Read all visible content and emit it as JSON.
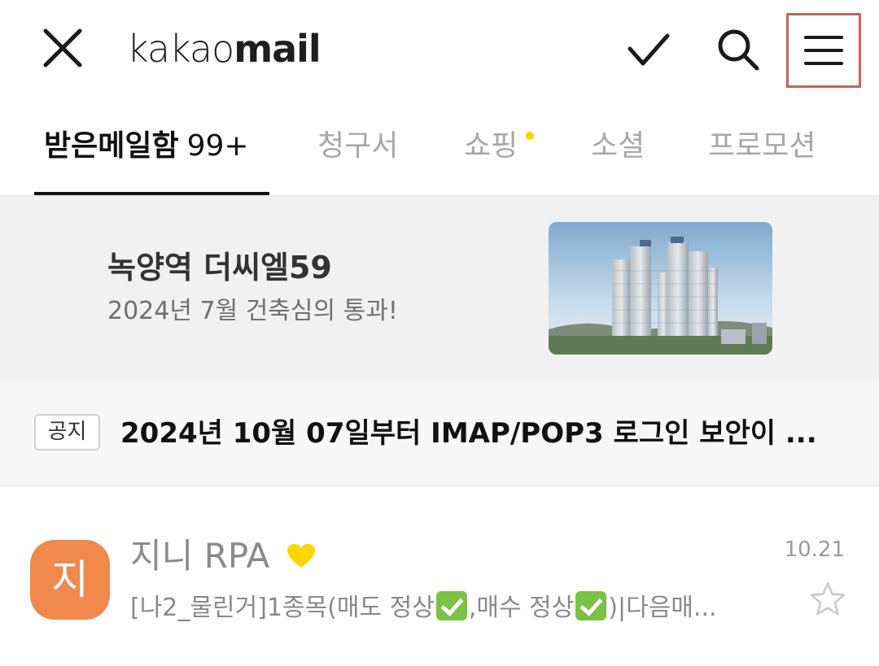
{
  "header": {
    "logo_light": "kakao",
    "logo_bold": "mail",
    "icons": {
      "close": "close-icon",
      "check": "check-icon",
      "search": "search-icon",
      "menu": "menu-icon"
    },
    "menu_highlight_color": "#c8654c"
  },
  "tabs": [
    {
      "label": "받은메일함",
      "count": "99+",
      "active": true
    },
    {
      "label": "청구서"
    },
    {
      "label": "쇼핑",
      "has_dot": true
    },
    {
      "label": "소셜"
    },
    {
      "label": "프로모션"
    }
  ],
  "banner": {
    "title": "녹양역 더씨엘59",
    "subtitle": "2024년 7월 건축심의 통과!"
  },
  "notice": {
    "badge": "공지",
    "text": "2024년 10월 07일부터 IMAP/POP3 로그인 보안이 ..."
  },
  "mails": [
    {
      "avatar_text": "지",
      "avatar_color": "#f0894b",
      "sender": "지니 RPA",
      "vip_icon": "heart-icon",
      "date": "10.21",
      "subject_parts": [
        "[나2_물린거]1종목(매도 정상",
        ",매수 정상",
        ")|다음매..."
      ],
      "starred": false
    }
  ]
}
